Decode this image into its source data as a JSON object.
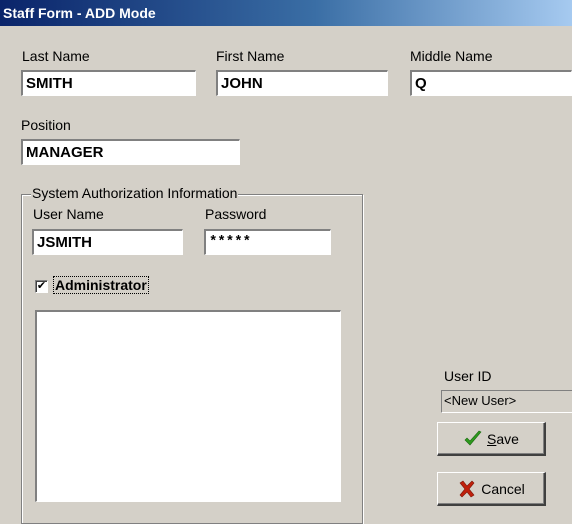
{
  "window": {
    "title": "Staff Form - ADD Mode"
  },
  "labels": {
    "last_name": "Last Name",
    "first_name": "First Name",
    "middle_name": "Middle Name",
    "position": "Position",
    "group_title": "System Authorization Information",
    "user_name": "User Name",
    "password": "Password",
    "administrator": "Administrator",
    "user_id": "User ID"
  },
  "fields": {
    "last_name": "SMITH",
    "first_name": "JOHN",
    "middle_name": "Q",
    "position": "MANAGER",
    "user_name": "JSMITH",
    "password": "*****",
    "user_id": "<New User>"
  },
  "checkbox": {
    "administrator_checked": true,
    "mark": "✔"
  },
  "buttons": {
    "save_label_key": "S",
    "save_label_rest": "ave",
    "cancel_label": "Cancel"
  },
  "icons": {
    "save": "check-icon",
    "cancel": "x-icon"
  },
  "colors": {
    "check_green": "#2e9a1e",
    "cancel_red": "#c0200c"
  }
}
